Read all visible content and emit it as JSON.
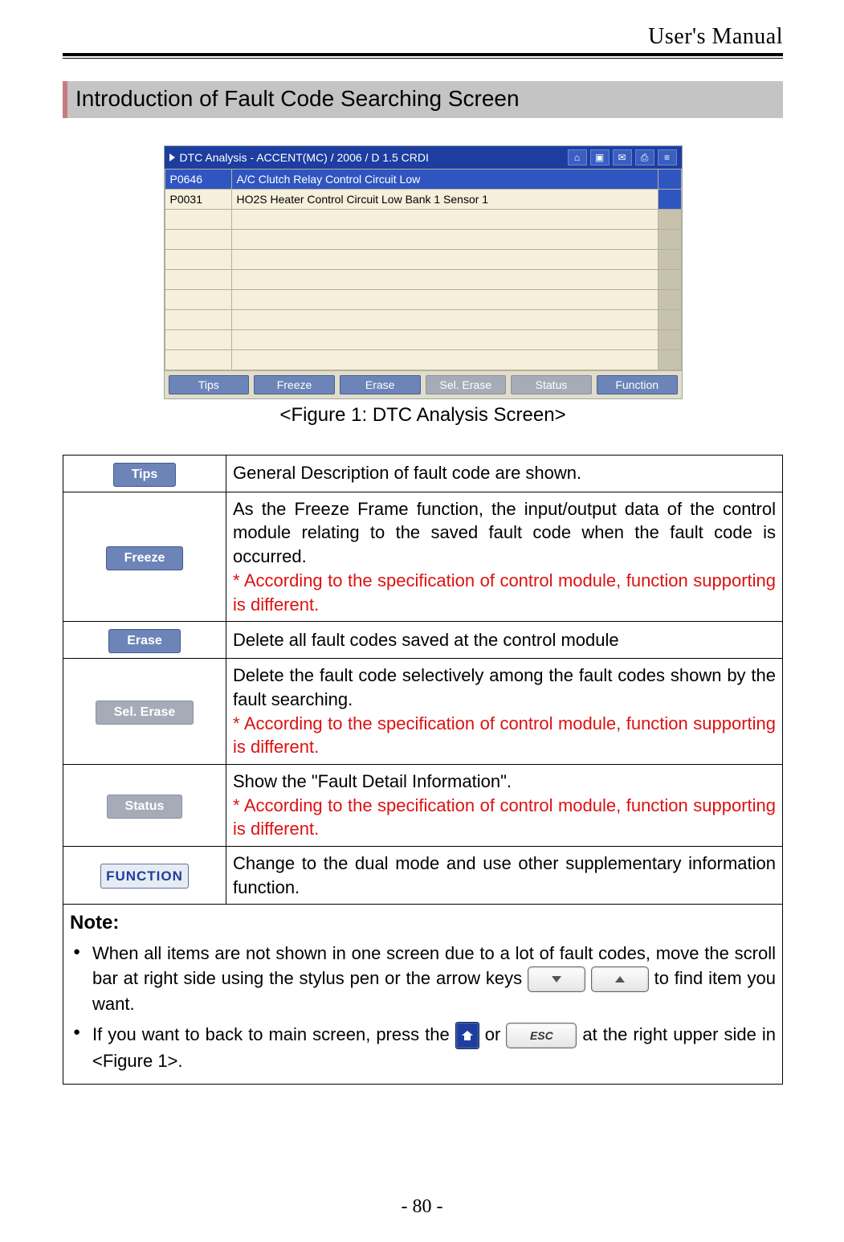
{
  "running_head": "User's Manual",
  "section_title": "Introduction of Fault Code Searching Screen",
  "screenshot": {
    "titlebar": "DTC Analysis - ACCENT(MC) / 2006 / D 1.5 CRDI",
    "icons": [
      "home",
      "camera",
      "msg",
      "print",
      "menu"
    ],
    "rows": [
      {
        "code": "P0646",
        "desc": "A/C Clutch Relay Control Circuit Low",
        "sel": true
      },
      {
        "code": "P0031",
        "desc": "HO2S Heater Control Circuit Low Bank 1  Sensor 1",
        "sel": false
      }
    ],
    "empty_rows": 8,
    "buttons": [
      {
        "label": "Tips",
        "disabled": false
      },
      {
        "label": "Freeze",
        "disabled": false
      },
      {
        "label": "Erase",
        "disabled": false
      },
      {
        "label": "Sel. Erase",
        "disabled": true
      },
      {
        "label": "Status",
        "disabled": true
      },
      {
        "label": "Function",
        "disabled": false
      }
    ]
  },
  "figure_caption": "<Figure 1: DTC Analysis Screen>",
  "desc_table": [
    {
      "btn": "Tips",
      "style": "normal",
      "text": "General Description of fault code are shown.",
      "note": ""
    },
    {
      "btn": "Freeze",
      "style": "normal",
      "text": "As the Freeze Frame function, the input/output data of the control module relating to the saved fault code when the fault code is occurred.",
      "note": "* According to the specification of control module, function supporting is different."
    },
    {
      "btn": "Erase",
      "style": "normal",
      "text": "Delete all fault codes saved at the control module",
      "note": ""
    },
    {
      "btn": "Sel. Erase",
      "style": "disabled",
      "text": "Delete the fault code selectively among the fault codes shown by the fault searching.",
      "note": "* According to the specification of control module, function supporting is different."
    },
    {
      "btn": "Status",
      "style": "disabled",
      "text": "Show the \"Fault Detail Information\".",
      "note": "* According to the specification of control module, function supporting is different."
    },
    {
      "btn": "FUNCTION",
      "style": "fn",
      "text": "Change to the dual mode and use other supplementary information function.",
      "note": ""
    }
  ],
  "note": {
    "heading": "Note:",
    "item1_a": "When all items are not shown in one screen due to a lot of fault codes, move the scroll bar at right side using the stylus pen or the arrow keys ",
    "item1_b": " to find item you want.",
    "item2_a": "If you want to back to main screen, press the ",
    "item2_b": " or ",
    "item2_c": " at the right upper side in <Figure 1>.",
    "esc_label": "ESC"
  },
  "page_number": "- 80 -"
}
